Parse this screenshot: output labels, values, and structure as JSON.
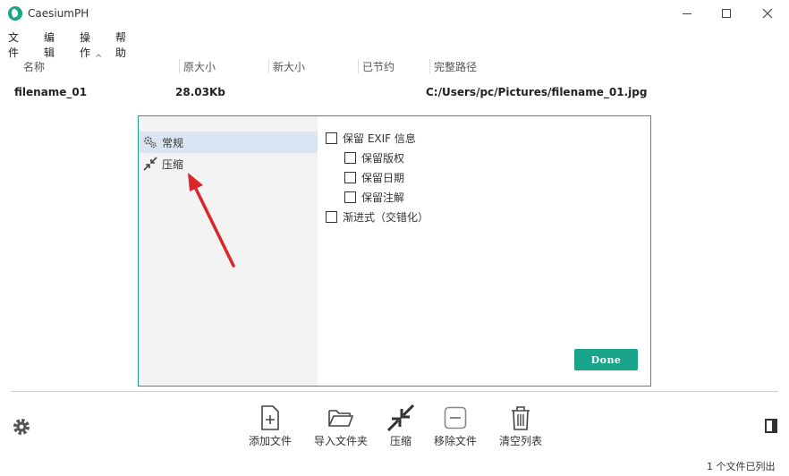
{
  "window": {
    "title": "CaesiumPH"
  },
  "menu": [
    "文件",
    "编辑",
    "操作",
    "帮助"
  ],
  "columns": [
    "名称",
    "原大小",
    "新大小",
    "已节约",
    "完整路径"
  ],
  "files": [
    {
      "name": "filename_01",
      "original_size": "28.03Kb",
      "new_size": "",
      "saved": "",
      "path": "C:/Users/pc/Pictures/filename_01.jpg"
    }
  ],
  "dialog": {
    "sidebar": [
      {
        "label": "常规",
        "icon": "gears-icon"
      },
      {
        "label": "压缩",
        "icon": "compress-icon"
      }
    ],
    "options": [
      {
        "label": "保留 EXIF 信息",
        "checked": false,
        "indent": 0
      },
      {
        "label": "保留版权",
        "checked": false,
        "indent": 1
      },
      {
        "label": "保留日期",
        "checked": false,
        "indent": 1
      },
      {
        "label": "保留注解",
        "checked": false,
        "indent": 1
      },
      {
        "label": "渐进式（交错化）",
        "checked": false,
        "indent": 0
      }
    ],
    "done_label": "Done"
  },
  "toolbar": [
    {
      "label": "添加文件",
      "icon": "add-file-icon"
    },
    {
      "label": "导入文件夹",
      "icon": "folder-open-icon"
    },
    {
      "label": "压缩",
      "icon": "compress-icon"
    },
    {
      "label": "移除文件",
      "icon": "remove-icon"
    },
    {
      "label": "清空列表",
      "icon": "trash-icon"
    }
  ],
  "status": "1 个文件已列出",
  "colors": {
    "accent": "#19a389",
    "arrow": "#d9262b",
    "selected": "#d9e6f1"
  }
}
